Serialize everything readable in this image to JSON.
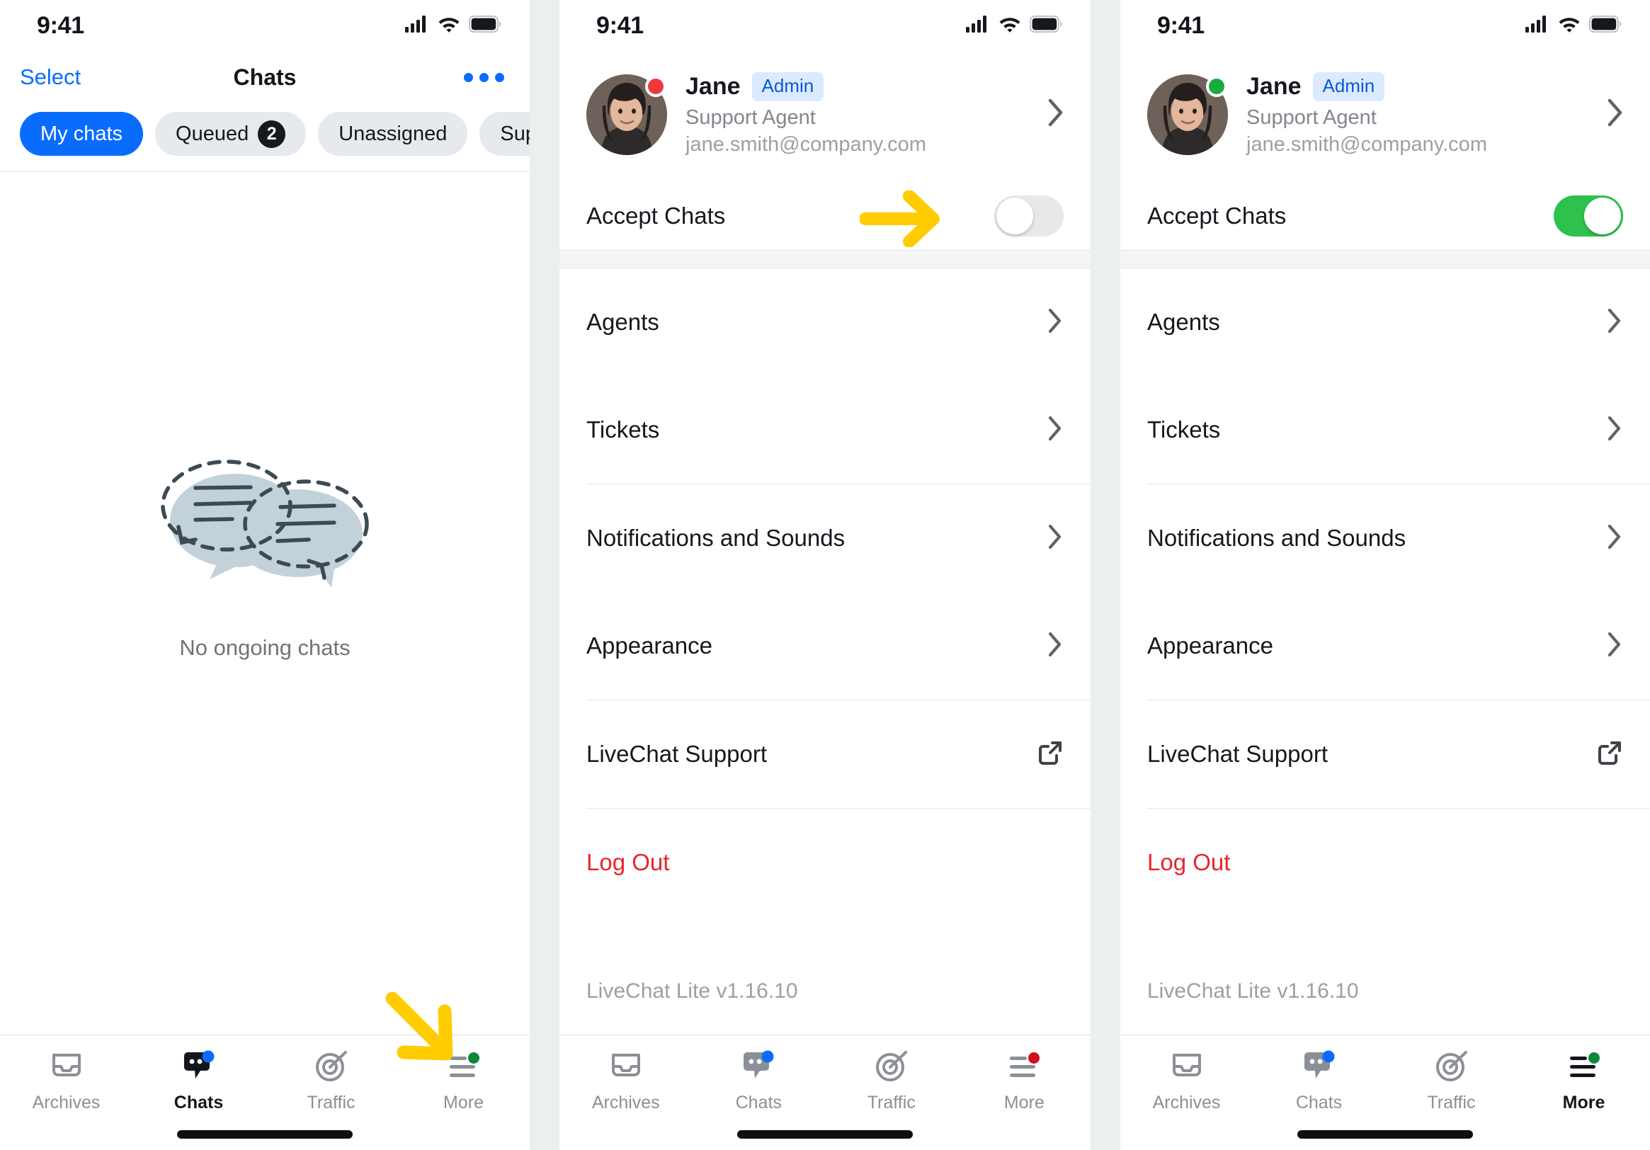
{
  "status_bar": {
    "time": "9:41",
    "icons": [
      "cellular-signal-icon",
      "wifi-icon",
      "battery-icon"
    ]
  },
  "panel_chats": {
    "nav": {
      "select_label": "Select",
      "title": "Chats",
      "more_menu_icon": "ellipsis-icon"
    },
    "filters": [
      {
        "label": "My chats",
        "badge": "",
        "active": true
      },
      {
        "label": "Queued",
        "badge": "2",
        "active": false
      },
      {
        "label": "Unassigned",
        "badge": "",
        "active": false
      },
      {
        "label": "Supervis",
        "badge": "",
        "active": false
      }
    ],
    "empty_state": {
      "illustration": "two-speech-bubbles-icon",
      "caption": "No ongoing chats"
    },
    "tabs": [
      {
        "label": "Archives",
        "icon": "archive-inbox-icon",
        "active": false,
        "dot": ""
      },
      {
        "label": "Chats",
        "icon": "chat-bubble-icon",
        "active": true,
        "dot": "#0a6cff"
      },
      {
        "label": "Traffic",
        "icon": "target-icon",
        "active": false,
        "dot": ""
      },
      {
        "label": "More",
        "icon": "hamburger-menu-icon",
        "active": false,
        "dot": "#0d8a39"
      }
    ],
    "annotation_arrow": "yellow-arrow-pointing-to-more-tab"
  },
  "panel_more_off": {
    "profile": {
      "name": "Jane",
      "badge": "Admin",
      "role": "Support Agent",
      "email": "jane.smith@company.com",
      "status_dot_color": "#f0393d",
      "chevron_icon": "chevron-right-icon"
    },
    "accept_chats": {
      "label": "Accept Chats",
      "enabled": false
    },
    "menu": [
      {
        "label": "Agents",
        "icon": "chevron-right-icon",
        "danger": false
      },
      {
        "label": "Tickets",
        "icon": "chevron-right-icon",
        "danger": false
      },
      {
        "label": "Notifications and Sounds",
        "icon": "chevron-right-icon",
        "danger": false
      },
      {
        "label": "Appearance",
        "icon": "chevron-right-icon",
        "danger": false
      },
      {
        "label": "LiveChat Support",
        "icon": "external-link-icon",
        "danger": false
      },
      {
        "label": "Log Out",
        "icon": "",
        "danger": true
      }
    ],
    "version": "LiveChat Lite v1.16.10",
    "tabs": [
      {
        "label": "Archives",
        "icon": "archive-inbox-icon",
        "active": false,
        "dot": ""
      },
      {
        "label": "Chats",
        "icon": "chat-bubble-icon",
        "active": false,
        "dot": "#0a6cff"
      },
      {
        "label": "Traffic",
        "icon": "target-icon",
        "active": false,
        "dot": ""
      },
      {
        "label": "More",
        "icon": "hamburger-menu-icon",
        "active": false,
        "dot": "#cf1020"
      }
    ],
    "annotation_arrow": "yellow-arrow-pointing-to-accept-chats-toggle"
  },
  "panel_more_on": {
    "profile": {
      "name": "Jane",
      "badge": "Admin",
      "role": "Support Agent",
      "email": "jane.smith@company.com",
      "status_dot_color": "#18ac3e",
      "chevron_icon": "chevron-right-icon"
    },
    "accept_chats": {
      "label": "Accept Chats",
      "enabled": true
    },
    "menu": [
      {
        "label": "Agents",
        "icon": "chevron-right-icon",
        "danger": false
      },
      {
        "label": "Tickets",
        "icon": "chevron-right-icon",
        "danger": false
      },
      {
        "label": "Notifications and Sounds",
        "icon": "chevron-right-icon",
        "danger": false
      },
      {
        "label": "Appearance",
        "icon": "chevron-right-icon",
        "danger": false
      },
      {
        "label": "LiveChat Support",
        "icon": "external-link-icon",
        "danger": false
      },
      {
        "label": "Log Out",
        "icon": "",
        "danger": true
      }
    ],
    "version": "LiveChat Lite v1.16.10",
    "tabs": [
      {
        "label": "Archives",
        "icon": "archive-inbox-icon",
        "active": false,
        "dot": ""
      },
      {
        "label": "Chats",
        "icon": "chat-bubble-icon",
        "active": false,
        "dot": "#0a6cff"
      },
      {
        "label": "Traffic",
        "icon": "target-icon",
        "active": false,
        "dot": ""
      },
      {
        "label": "More",
        "icon": "hamburger-menu-icon",
        "active": true,
        "dot": "#0d8a39"
      }
    ]
  },
  "colors": {
    "accent_blue": "#0a6cff",
    "toggle_on_green": "#2ec14e",
    "danger_red": "#e8252b",
    "annotation_yellow": "#fc0",
    "page_background": "#e9f0ee"
  }
}
